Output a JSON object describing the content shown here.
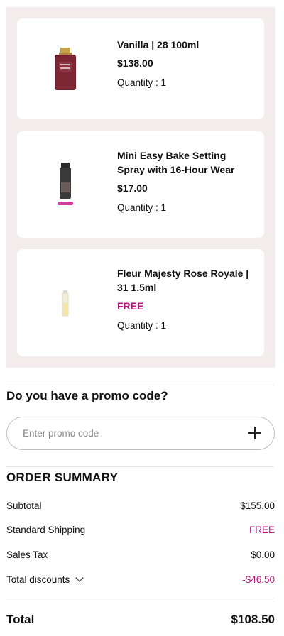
{
  "cart": {
    "items": [
      {
        "name": "Vanilla | 28 100ml",
        "price": "$138.00",
        "quantity": "Quantity : 1"
      },
      {
        "name": "Mini Easy Bake Setting Spray with 16-Hour Wear",
        "price": "$17.00",
        "quantity": "Quantity : 1"
      },
      {
        "name": "Fleur Majesty Rose Royale | 31 1.5ml",
        "price": "FREE",
        "quantity": "Quantity : 1"
      }
    ]
  },
  "promo": {
    "title": "Do you have a promo code?",
    "placeholder": "Enter promo code"
  },
  "summary": {
    "title": "ORDER SUMMARY",
    "subtotal_label": "Subtotal",
    "subtotal_value": "$155.00",
    "shipping_label": "Standard Shipping",
    "shipping_value": "FREE",
    "tax_label": "Sales Tax",
    "tax_value": "$0.00",
    "discounts_label": "Total discounts",
    "discounts_value": "-$46.50",
    "total_label": "Total",
    "total_value": "$108.50"
  },
  "colors": {
    "accent": "#b5177a",
    "cart_background": "#f3ecec"
  }
}
